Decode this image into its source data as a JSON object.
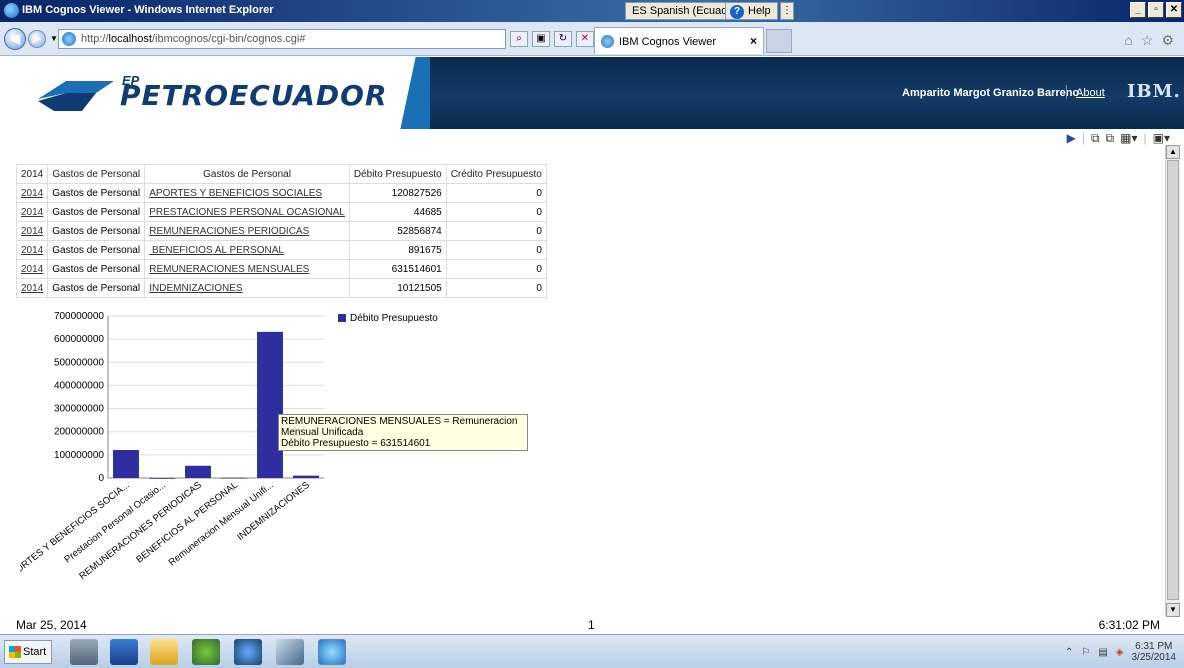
{
  "window": {
    "title": "IBM Cognos Viewer - Windows Internet Explorer",
    "language": "ES Spanish (Ecuador)",
    "help": "Help",
    "controls": [
      "_",
      "▫",
      "✕"
    ]
  },
  "browser": {
    "url_prefix": "http://",
    "url_host": "localhost",
    "url_path": "/ibmcognos/cgi-bin/cognos.cgi#",
    "tab_label": "IBM Cognos Viewer"
  },
  "header": {
    "brand_ep": "EP",
    "brand_name": "PETROECUADOR",
    "user": "Amparito Margot Granizo Barreno",
    "about": "About",
    "ibm": "IBM."
  },
  "table": {
    "headers": [
      "2014",
      "Gastos de Personal",
      "Gastos de Personal",
      "Débito Presupuesto",
      "Crédito Presupuesto"
    ],
    "rows": [
      {
        "year": "2014",
        "group": "Gastos de Personal",
        "item": "APORTES Y BENEFICIOS SOCIALES",
        "debito": "120827526",
        "credito": "0"
      },
      {
        "year": "2014",
        "group": "Gastos de Personal",
        "item": "PRESTACIONES PERSONAL OCASIONAL",
        "debito": "44685",
        "credito": "0"
      },
      {
        "year": "2014",
        "group": "Gastos de Personal",
        "item": "REMUNERACIONES PERIODICAS",
        "debito": "52856874",
        "credito": "0"
      },
      {
        "year": "2014",
        "group": "Gastos de Personal",
        "item": " BENEFICIOS AL PERSONAL",
        "debito": "891675",
        "credito": "0"
      },
      {
        "year": "2014",
        "group": "Gastos de Personal",
        "item": "REMUNERACIONES MENSUALES",
        "debito": "631514601",
        "credito": "0"
      },
      {
        "year": "2014",
        "group": "Gastos de Personal",
        "item": "INDEMNIZACIONES",
        "debito": "10121505",
        "credito": "0"
      }
    ]
  },
  "chart_data": {
    "type": "bar",
    "categories": [
      "APORTES Y BENEFICIOS SOCIA...",
      "Prestacion Personal Ocasio...",
      "REMUNERACIONES PERIODICAS",
      "BENEFICIOS AL PERSONAL",
      "Remuneracion Mensual Unifi...",
      "INDEMNIZACIONES"
    ],
    "series": [
      {
        "name": "Débito Presupuesto",
        "values": [
          120827526,
          44685,
          52856874,
          891675,
          631514601,
          10121505
        ]
      }
    ],
    "yticks": [
      "700000000",
      "600000000",
      "500000000",
      "400000000",
      "300000000",
      "200000000",
      "100000000",
      "0"
    ],
    "ylim": [
      0,
      700000000
    ],
    "legend_position": "top-right",
    "color": "#2e2e9e"
  },
  "tooltip": {
    "line1": "REMUNERACIONES MENSUALES = Remuneracion Mensual Unificada",
    "line2": "Débito Presupuesto = 631514601"
  },
  "footer": {
    "date": "Mar 25, 2014",
    "page": "1",
    "time": "6:31:02 PM"
  },
  "taskbar": {
    "start": "Start",
    "clock_time": "6:31 PM",
    "clock_date": "3/25/2014"
  }
}
